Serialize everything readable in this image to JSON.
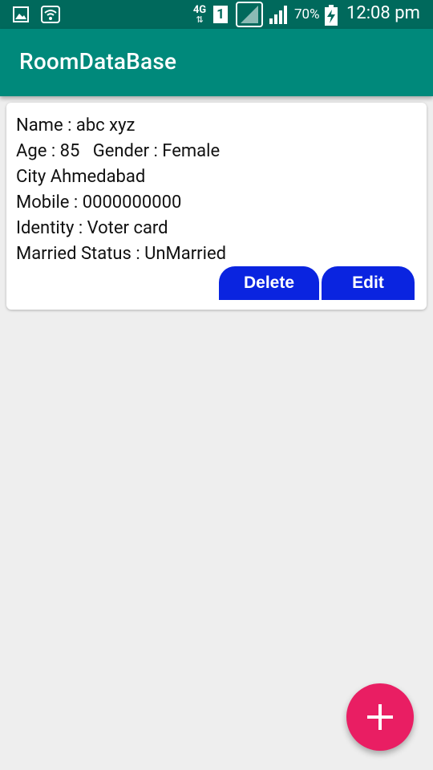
{
  "status_bar": {
    "network_label": "4G",
    "sim_number": "1",
    "battery_percent": "70%",
    "time": "12:08 pm",
    "icons": [
      "gallery-icon",
      "wifi-icon",
      "4g-icon",
      "sim-icon",
      "signal-icon",
      "battery-charging-icon"
    ]
  },
  "app_bar": {
    "title": "RoomDataBase"
  },
  "records": [
    {
      "name_line": "Name : abc xyz",
      "age_gender_line": "Age : 85   Gender : Female",
      "city_line": "City Ahmedabad",
      "mobile_line": "Mobile : 0000000000",
      "identity_line": "Identity : Voter card",
      "married_line": "Married Status : UnMarried",
      "delete_label": "Delete",
      "edit_label": "Edit"
    }
  ],
  "fab": {
    "icon": "plus-icon"
  },
  "colors": {
    "status_bar": "#00695c",
    "app_bar": "#00897b",
    "background": "#eeeeee",
    "button": "#0a24e0",
    "fab": "#e91e63"
  }
}
